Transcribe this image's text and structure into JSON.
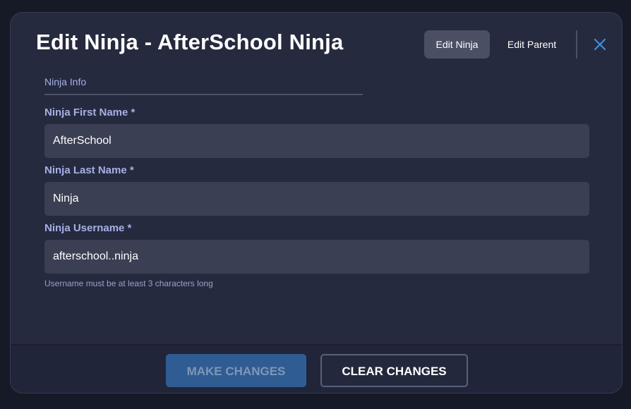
{
  "modal": {
    "title": "Edit Ninja - AfterSchool Ninja",
    "tabs": {
      "edit_ninja": "Edit Ninja",
      "edit_parent": "Edit Parent"
    }
  },
  "section": {
    "label": "Ninja Info"
  },
  "fields": {
    "first_name": {
      "label": "Ninja First Name *",
      "value": "AfterSchool"
    },
    "last_name": {
      "label": "Ninja Last Name *",
      "value": "Ninja"
    },
    "username": {
      "label": "Ninja Username *",
      "value": "afterschool..ninja",
      "helper": "Username must be at least 3 characters long"
    }
  },
  "footer": {
    "make_changes": "MAKE CHANGES",
    "clear_changes": "CLEAR CHANGES"
  },
  "colors": {
    "accent": "#2f5d93",
    "close_icon": "#3d8fe0",
    "label": "#a7b0e6"
  },
  "icons": {
    "close": "close-icon"
  }
}
